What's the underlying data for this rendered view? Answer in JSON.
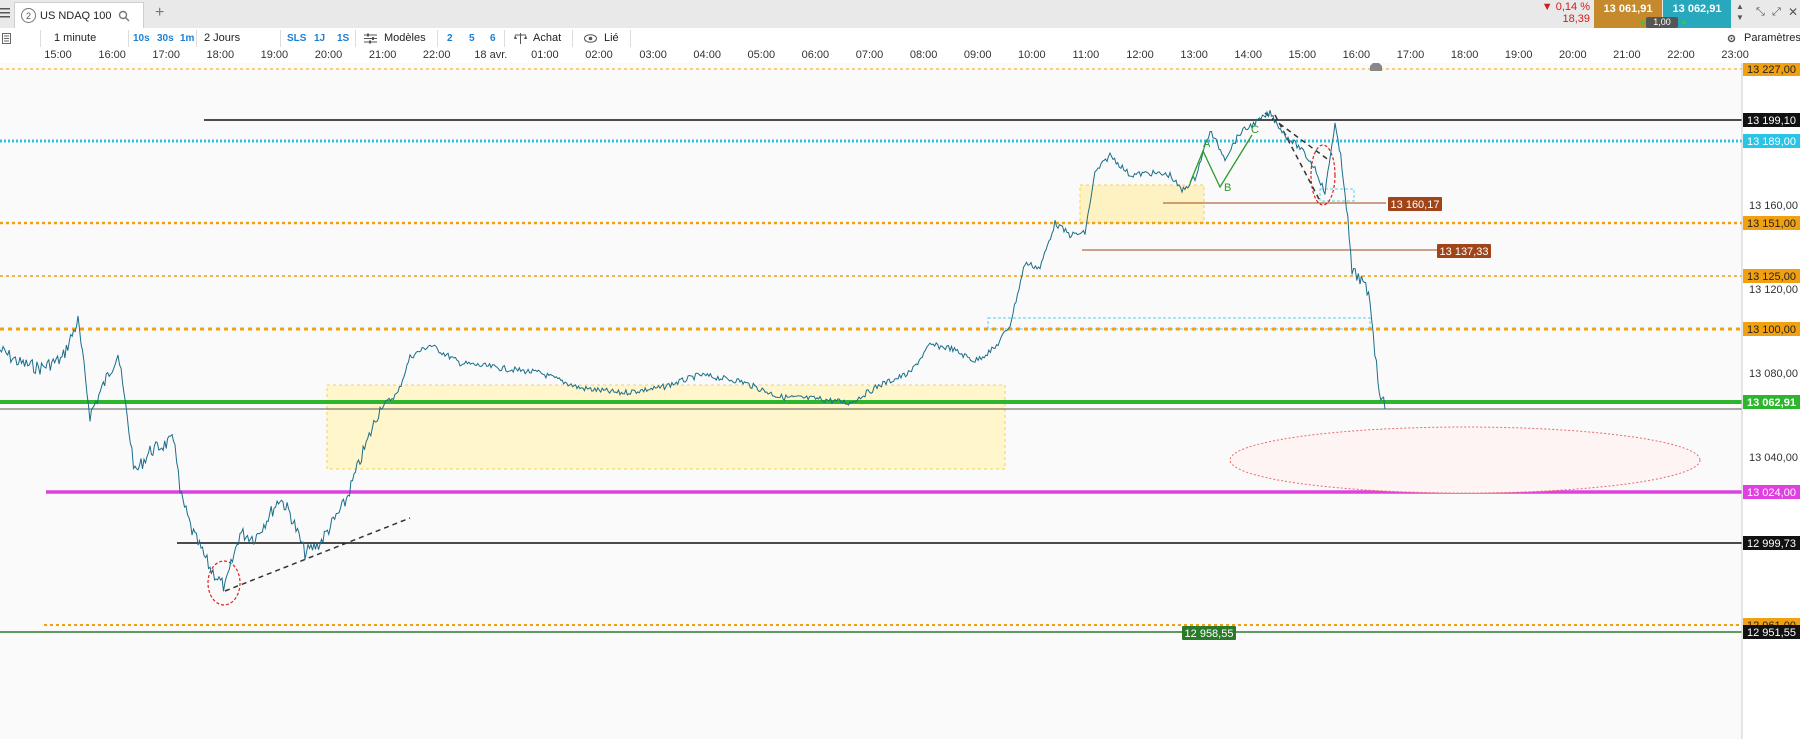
{
  "window": {
    "instrument": "US NDAQ 100",
    "tab_number": "2"
  },
  "quote": {
    "change_pct": "▼ 0,14 %",
    "change_abs": "18,39",
    "bid": "13 061,91",
    "ask": "13 062,91",
    "lot": "1,00",
    "colors": {
      "bid_bg": "#c58a2c",
      "ask_bg": "#27a8bd",
      "change": "#d11b1b"
    }
  },
  "toolbar": {
    "timeframe": "1 minute",
    "presets": [
      "10s",
      "30s",
      "1m"
    ],
    "period": "2 Jours",
    "modes": [
      "SLS",
      "1J",
      "1S"
    ],
    "models_label": "Modèles",
    "counts": [
      "2",
      "5",
      "6"
    ],
    "buy_label": "Achat",
    "linked_label": "Lié",
    "settings_label": "Paramètres"
  },
  "time_axis": [
    "15:00",
    "16:00",
    "17:00",
    "18:00",
    "19:00",
    "20:00",
    "21:00",
    "22:00",
    "18 avr.",
    "01:00",
    "02:00",
    "03:00",
    "04:00",
    "05:00",
    "06:00",
    "07:00",
    "08:00",
    "09:00",
    "10:00",
    "11:00",
    "12:00",
    "13:00",
    "14:00",
    "15:00",
    "16:00",
    "17:00",
    "18:00",
    "19:00",
    "20:00",
    "21:00",
    "22:00",
    "23:00"
  ],
  "price_axis": {
    "scale_labels": [
      "13 160,00",
      "13 120,00",
      "13 080,00",
      "13 040,00"
    ],
    "levels": [
      {
        "label": "13 227,00",
        "color": "#f0a010",
        "style": "dotted"
      },
      {
        "label": "13 199,10",
        "color": "#111111",
        "style": "solid"
      },
      {
        "label": "13 189,00",
        "color": "#29c4e6",
        "style": "dotted"
      },
      {
        "label": "13 151,00",
        "color": "#f0a010",
        "style": "dotted"
      },
      {
        "label": "13 125,00",
        "color": "#f0a010",
        "style": "dotted"
      },
      {
        "label": "13 100,00",
        "color": "#f0a010",
        "style": "dotted"
      },
      {
        "label": "13 062,91",
        "color": "#2db52d",
        "style": "solid"
      },
      {
        "label": "13 024,00",
        "color": "#e040e0",
        "style": "solid"
      },
      {
        "label": "12 999,73",
        "color": "#111111",
        "style": "solid"
      },
      {
        "label": "12 961,00",
        "color": "#f0a010",
        "style": "dotted"
      },
      {
        "label": "12 951,55",
        "color": "#111111",
        "style": "solid"
      }
    ]
  },
  "annotations": {
    "inline_labels": [
      "13 160,17",
      "13 137,33",
      "12 958,55"
    ],
    "wave_labels": [
      "A",
      "B",
      "C"
    ]
  },
  "chart_data": {
    "type": "line",
    "title": "",
    "xlabel": "",
    "ylabel": "",
    "x": [
      "15:00",
      "16:00",
      "17:00",
      "18:00",
      "19:00",
      "20:00",
      "21:00",
      "22:00",
      "00:00",
      "01:00",
      "02:00",
      "03:00",
      "04:00",
      "05:00",
      "06:00",
      "07:00",
      "08:00",
      "09:00",
      "10:00",
      "11:00",
      "12:00",
      "13:00",
      "14:00",
      "15:00",
      "16:00"
    ],
    "series": [
      {
        "values": [
          13090,
          13085,
          13050,
          12975,
          13010,
          12995,
          13040,
          13085,
          13082,
          13078,
          13074,
          13072,
          13078,
          13074,
          13068,
          13066,
          13088,
          13098,
          13128,
          13175,
          13168,
          13165,
          13195,
          13170,
          13060
        ]
      }
    ],
    "ylim": [
      12951,
      13233
    ],
    "grid": false,
    "color": "#1a6e8a"
  }
}
